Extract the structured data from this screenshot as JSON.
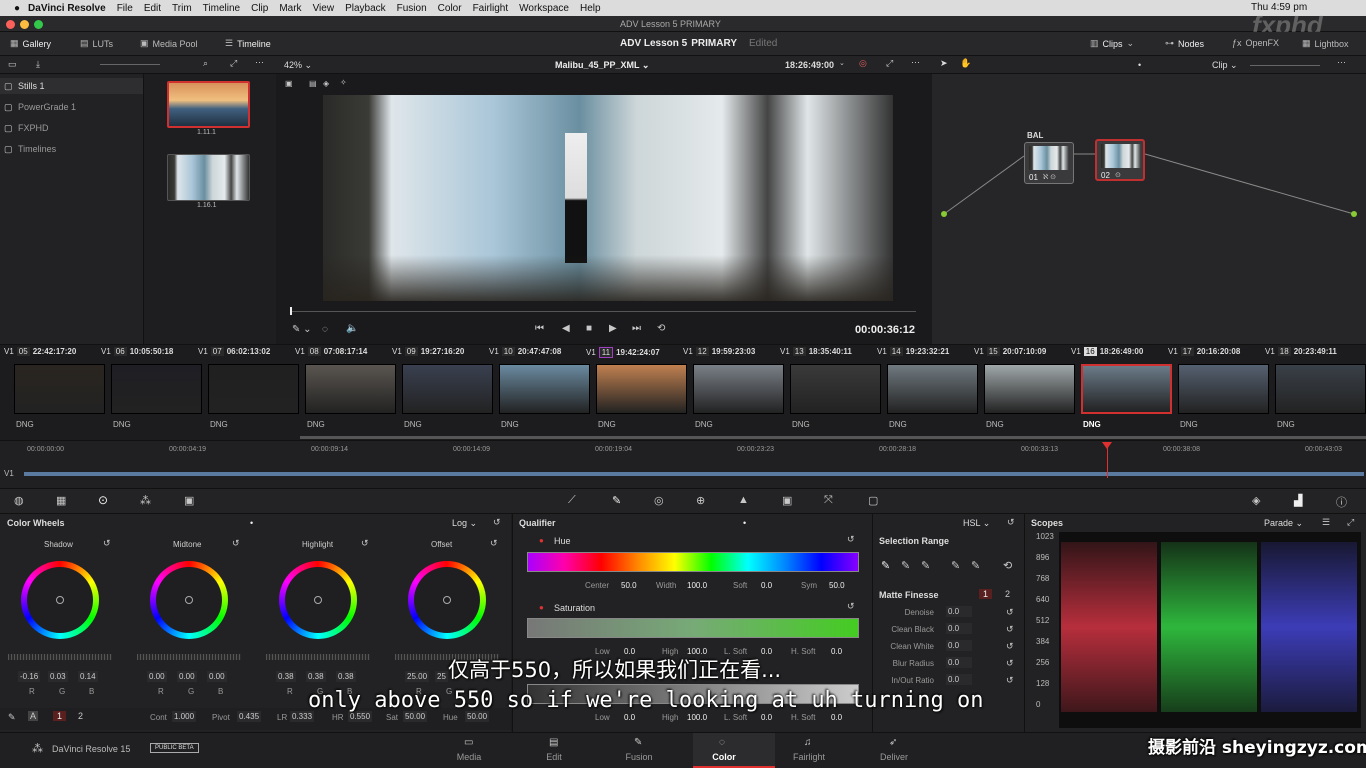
{
  "menubar": {
    "app": "DaVinci Resolve",
    "items": [
      "File",
      "Edit",
      "Trim",
      "Timeline",
      "Clip",
      "Mark",
      "View",
      "Playback",
      "Fusion",
      "Color",
      "Fairlight",
      "Workspace",
      "Help"
    ],
    "clock": "Thu 4:59 pm"
  },
  "window": {
    "title": "ADV Lesson 5  PRIMARY"
  },
  "toolbar": {
    "gallery": "Gallery",
    "luts": "LUTs",
    "media_pool": "Media Pool",
    "timeline": "Timeline",
    "project": "ADV Lesson 5",
    "mode": "PRIMARY",
    "status": "Edited",
    "clips": "Clips",
    "nodes": "Nodes",
    "openfx": "OpenFX",
    "lightbox": "Lightbox"
  },
  "viewer": {
    "zoom": "42%",
    "clip_name": "Malibu_45_PP_XML",
    "timecode_top": "18:26:49:00",
    "timecode": "00:00:36:12"
  },
  "gallery": {
    "albums": [
      "Stills 1",
      "PowerGrade 1",
      "FXPHD",
      "Timelines"
    ],
    "stills": [
      "1.11.1",
      "1.16.1"
    ]
  },
  "nodes": {
    "label": "BAL",
    "mode": "Clip",
    "node1": "01",
    "node2": "02"
  },
  "clips": [
    {
      "n": "05",
      "tc": "22:42:17:20",
      "tr": "V1",
      "fmt": "DNG"
    },
    {
      "n": "06",
      "tc": "10:05:50:18",
      "tr": "V1",
      "fmt": "DNG"
    },
    {
      "n": "07",
      "tc": "06:02:13:02",
      "tr": "V1",
      "fmt": "DNG"
    },
    {
      "n": "08",
      "tc": "07:08:17:14",
      "tr": "V1",
      "fmt": "DNG"
    },
    {
      "n": "09",
      "tc": "19:27:16:20",
      "tr": "V1",
      "fmt": "DNG"
    },
    {
      "n": "10",
      "tc": "20:47:47:08",
      "tr": "V1",
      "fmt": "DNG"
    },
    {
      "n": "11",
      "tc": "19:42:24:07",
      "tr": "V1",
      "fmt": "DNG"
    },
    {
      "n": "12",
      "tc": "19:59:23:03",
      "tr": "V1",
      "fmt": "DNG"
    },
    {
      "n": "13",
      "tc": "18:35:40:11",
      "tr": "V1",
      "fmt": "DNG"
    },
    {
      "n": "14",
      "tc": "19:23:32:21",
      "tr": "V1",
      "fmt": "DNG"
    },
    {
      "n": "15",
      "tc": "20:07:10:09",
      "tr": "V1",
      "fmt": "DNG"
    },
    {
      "n": "16",
      "tc": "18:26:49:00",
      "tr": "V1",
      "fmt": "DNG"
    },
    {
      "n": "17",
      "tc": "20:16:20:08",
      "tr": "V1",
      "fmt": "DNG"
    },
    {
      "n": "18",
      "tc": "20:23:49:11",
      "tr": "V1",
      "fmt": "DNG"
    }
  ],
  "ruler": [
    "00:00:00:00",
    "00:00:04:19",
    "00:00:09:14",
    "00:00:14:09",
    "00:00:19:04",
    "00:00:23:23",
    "00:00:28:18",
    "00:00:33:13",
    "00:00:38:08",
    "00:00:43:03"
  ],
  "track_label": "V1",
  "color_wheels": {
    "title": "Color Wheels",
    "mode": "Log",
    "wheels": [
      {
        "name": "Shadow",
        "r": "-0.16",
        "g": "0.03",
        "b": "0.14"
      },
      {
        "name": "Midtone",
        "r": "0.00",
        "g": "0.00",
        "b": "0.00"
      },
      {
        "name": "Highlight",
        "r": "0.38",
        "g": "0.38",
        "b": "0.38"
      },
      {
        "name": "Offset",
        "r": "25.00",
        "g": "25",
        "b": ""
      }
    ],
    "rgb": [
      "R",
      "G",
      "B"
    ],
    "page1": "1",
    "page2": "2",
    "footer": {
      "cont_l": "Cont",
      "cont": "1.000",
      "pivot_l": "Pivot",
      "pivot": "0.435",
      "lr_l": "LR",
      "lr": "0.333",
      "hr_l": "HR",
      "hr": "0.550",
      "sat_l": "Sat",
      "sat": "50.00",
      "hue_l": "Hue",
      "hue": "50.00"
    }
  },
  "qualifier": {
    "title": "Qualifier",
    "mode": "HSL",
    "hue": "Hue",
    "center_l": "Center",
    "center": "50.0",
    "width_l": "Width",
    "width": "100.0",
    "soft_l": "Soft",
    "soft": "0.0",
    "sym_l": "Sym",
    "sym": "50.0",
    "saturation": "Saturation",
    "low_l": "Low",
    "low": "0.0",
    "high_l": "High",
    "high": "100.0",
    "lsoft_l": "L. Soft",
    "lsoft": "0.0",
    "hsoft_l": "H. Soft",
    "hsoft": "0.0",
    "low2": "0.0",
    "high2": "100.0",
    "lsoft2": "0.0",
    "hsoft2": "0.0"
  },
  "selection": {
    "title": "Selection Range",
    "matte": "Matte Finesse",
    "p1": "1",
    "p2": "2",
    "rows": [
      {
        "l": "Denoise",
        "v": "0.0"
      },
      {
        "l": "Clean Black",
        "v": "0.0"
      },
      {
        "l": "Clean White",
        "v": "0.0"
      },
      {
        "l": "Blur Radius",
        "v": "0.0"
      },
      {
        "l": "In/Out Ratio",
        "v": "0.0"
      }
    ]
  },
  "scopes": {
    "title": "Scopes",
    "mode": "Parade",
    "ticks": [
      "1023",
      "896",
      "768",
      "640",
      "512",
      "384",
      "256",
      "128",
      "0"
    ]
  },
  "bottom": {
    "brand": "DaVinci Resolve 15",
    "beta": "PUBLIC BETA",
    "nav": [
      "Media",
      "Edit",
      "Fusion",
      "Color",
      "Fairlight",
      "Deliver"
    ]
  },
  "subtitles": {
    "cn": "仅高于550，所以如果我们正在看...",
    "en": "only above 550 so if we're looking at uh turning on"
  },
  "watermark": {
    "fxphd": "fxphd",
    "site": "摄影前沿 sheyingzyz.com"
  }
}
